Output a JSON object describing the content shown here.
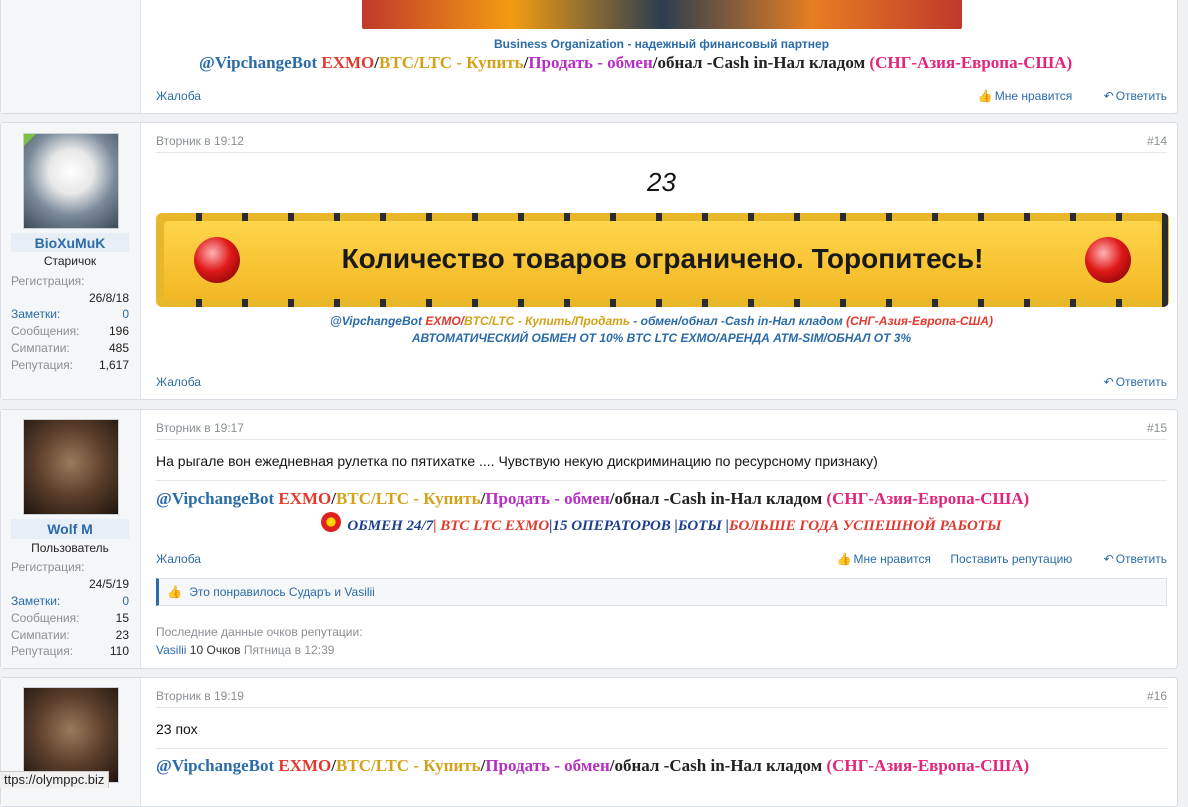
{
  "colors": {
    "link": "#2a6ba8",
    "red": "#e03a2f",
    "gold": "#d4a21a",
    "purple": "#b62ec4",
    "pink": "#e3247a",
    "navy": "#1d3f8c"
  },
  "top_post": {
    "banner_caption": "Business Organization - надежный финансовый партнер",
    "sig": {
      "bot": "@VipchangeBot",
      "exmo": "EXMO",
      "slash": "/",
      "btc": "BTC/LTC - Купить",
      "slash2": "/",
      "sell": "Продать - обмен",
      "cash": "/обнал -Cash in-Нал кладом",
      "region": "(СНГ-Азия-Европа-США)"
    },
    "report": "Жалоба",
    "like": "Мне нравится",
    "reply": "Ответить"
  },
  "posts": [
    {
      "user": {
        "name": "BioXuMuK",
        "title": "Старичок",
        "reg_label": "Регистрация:",
        "reg_date": "26/8/18",
        "notes_label": "Заметки:",
        "notes": "0",
        "msgs_label": "Сообщения:",
        "msgs": "196",
        "likes_label": "Симпатии:",
        "likes": "485",
        "rep_label": "Репутация:",
        "rep": "1,617"
      },
      "time": "Вторник в 19:12",
      "num": "#14",
      "body": "23",
      "banner_text": "Количество товаров ограничено. Торопитесь!",
      "sig1": {
        "bot": "@VipchangeBot",
        "exmo": "EXMO/",
        "btc": "BTC/LTC - Купить/Продать",
        "rest": " - обмен/обнал -Cash in-Нал кладом ",
        "region": "(СНГ-Азия-Европа-США)"
      },
      "sig2": "АВТОМАТИЧЕСКИЙ ОБМЕН ОТ 10% BTC LTC EXMO/АРЕНДА ATM-SIM/ОБНАЛ ОТ 3%",
      "report": "Жалоба",
      "reply": "Ответить"
    },
    {
      "user": {
        "name": "Wolf M",
        "title": "Пользователь",
        "reg_label": "Регистрация:",
        "reg_date": "24/5/19",
        "notes_label": "Заметки:",
        "notes": "0",
        "msgs_label": "Сообщения:",
        "msgs": "15",
        "likes_label": "Симпатии:",
        "likes": "23",
        "rep_label": "Репутация:",
        "rep": "110"
      },
      "time": "Вторник в 19:17",
      "num": "#15",
      "body": "На рыгале вон ежедневная рулетка по пятихатке .... Чувствую некую дискриминацию по ресурсному признаку)",
      "sig": {
        "bot": "@VipchangeBot",
        "exmo": "EXMO",
        "slash": "/",
        "btc": "BTC/LTC - Купить",
        "slash2": "/",
        "sell": "Продать - обмен",
        "cash": "/обнал -Cash in-Нал кладом",
        "region": "(СНГ-Азия-Европа-США)"
      },
      "sig2": {
        "a": "ОБМЕН 24/7",
        "b": "| BTC LTC EXMO",
        "c": "|15 ОПЕРАТОРОВ |",
        "d": "БОТЫ",
        "e": " |",
        "f": "БОЛЬШЕ ГОДА УСПЕШНОЙ РАБОТЫ"
      },
      "report": "Жалоба",
      "like": "Мне нравится",
      "rep_btn": "Поставить репутацию",
      "reply": "Ответить",
      "liked_by": "Это понравилось Сударъ и Vasilii",
      "rep_head": "Последние данные очков репутации:",
      "rep_user": "Vasilii",
      "rep_points": "10 Очков",
      "rep_time": "Пятница в 12:39"
    },
    {
      "time": "Вторник в 19:19",
      "num": "#16",
      "body": "23 пох",
      "sig": {
        "bot": "@VipchangeBot",
        "exmo": "EXMO",
        "slash": "/",
        "btc": "BTC/LTC - Купить",
        "slash2": "/",
        "sell": "Продать - обмен",
        "cash": "/обнал -Cash in-Нал кладом",
        "region": "(СНГ-Азия-Европа-США)"
      }
    }
  ],
  "status_url": "ttps://olympрс.biz"
}
